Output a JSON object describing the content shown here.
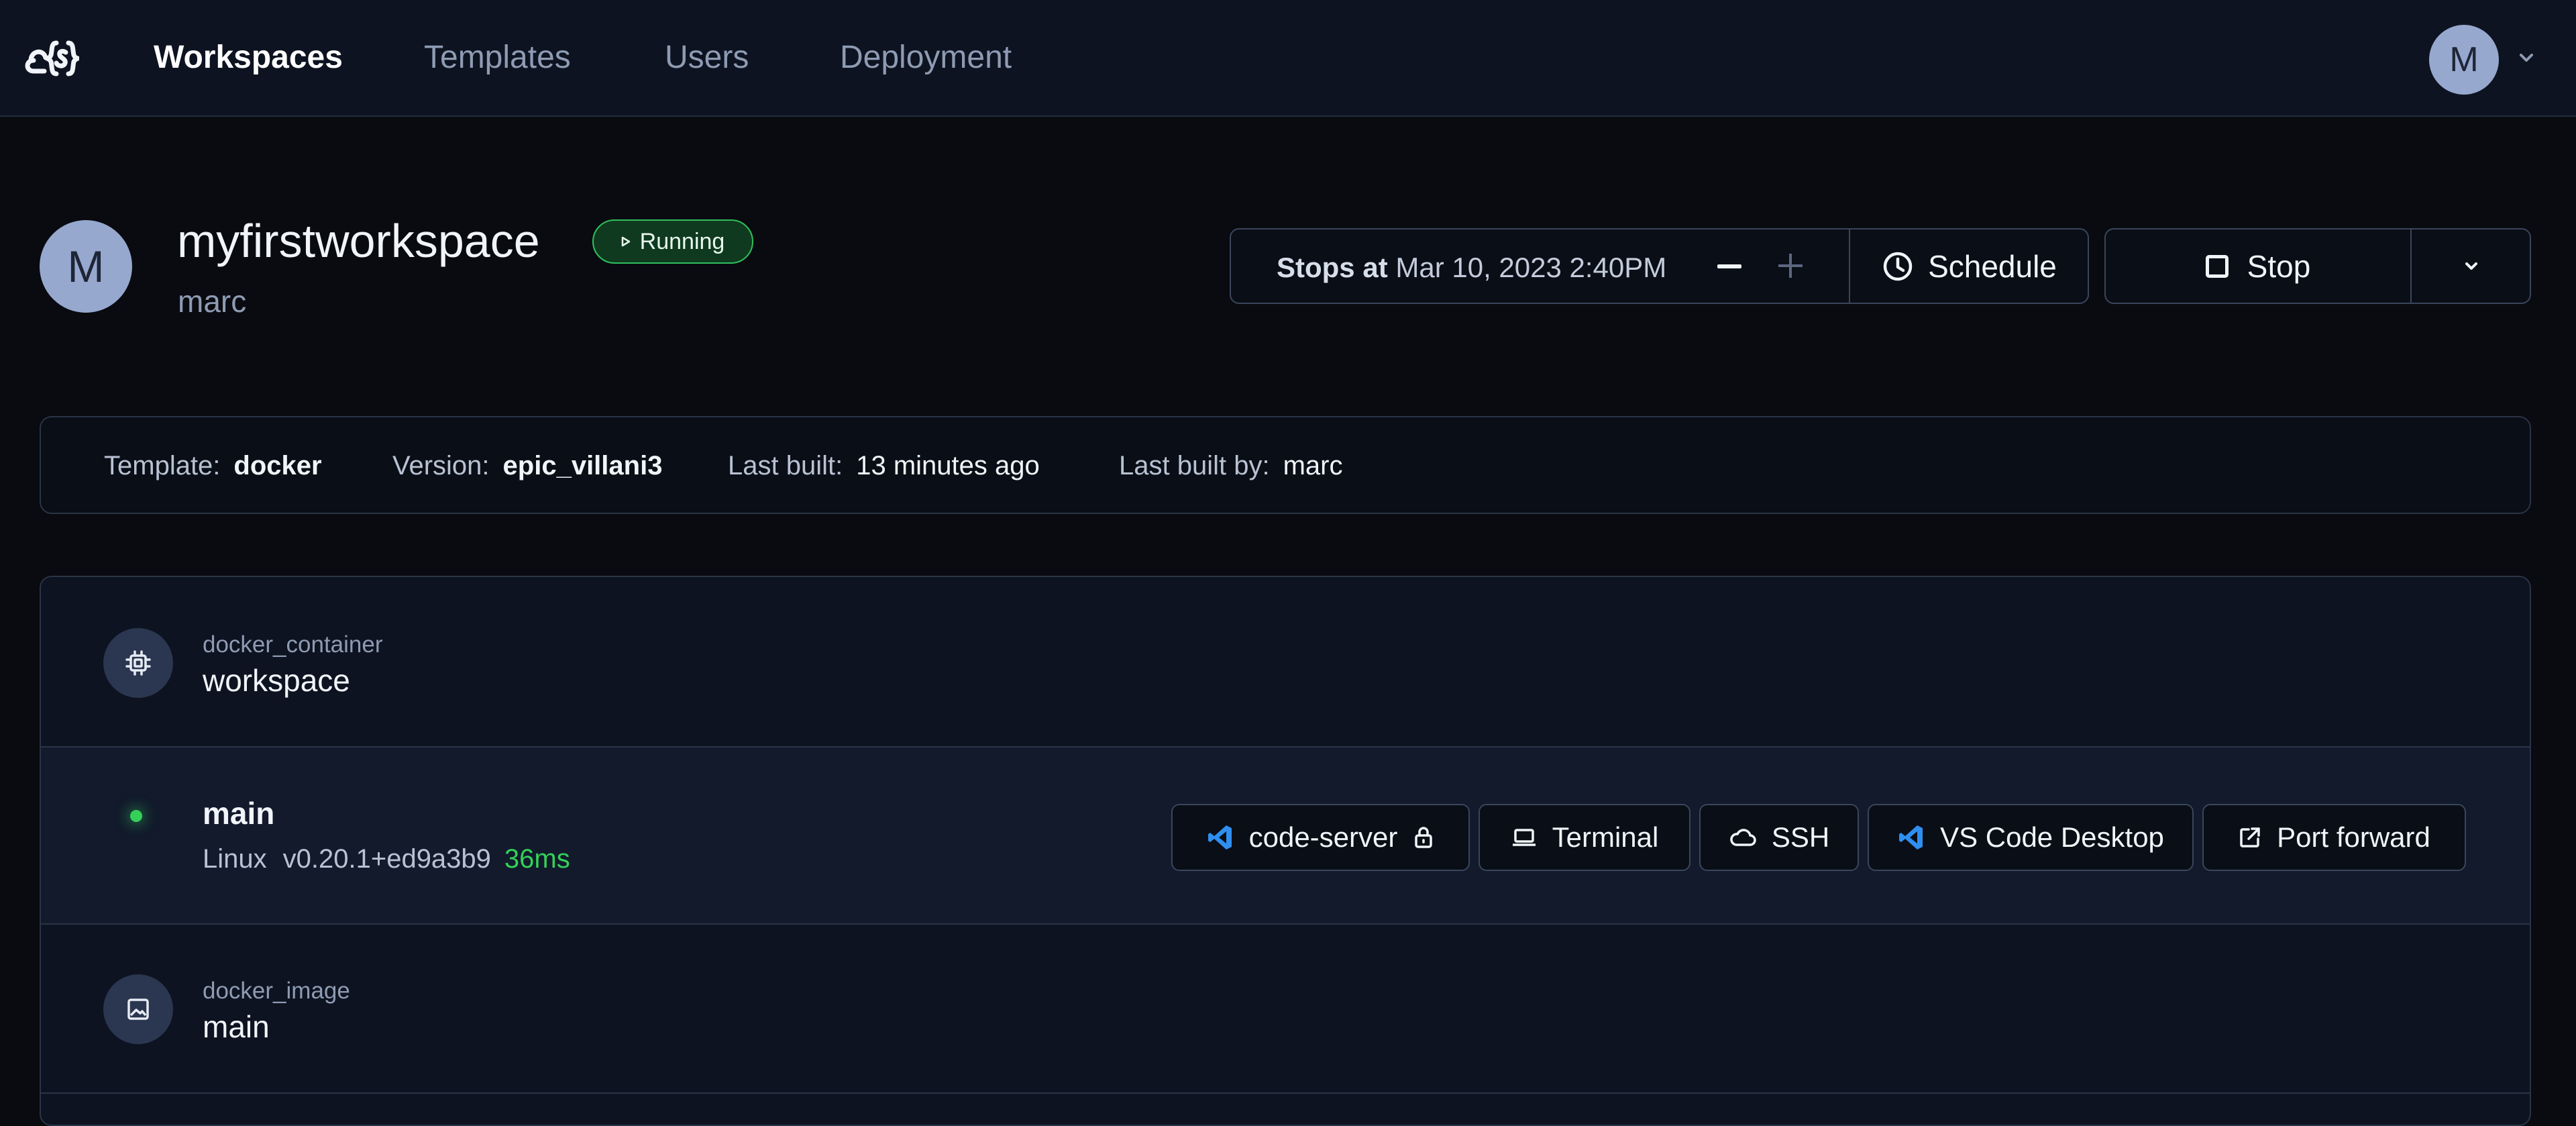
{
  "nav": {
    "items": [
      {
        "label": "Workspaces",
        "active": true
      },
      {
        "label": "Templates",
        "active": false
      },
      {
        "label": "Users",
        "active": false
      },
      {
        "label": "Deployment",
        "active": false
      }
    ],
    "user_initial": "M"
  },
  "workspace": {
    "initial": "M",
    "name": "myfirstworkspace",
    "owner": "marc",
    "status": "Running"
  },
  "schedule": {
    "stops_label": "Stops at",
    "stops_value": "Mar 10, 2023 2:40PM",
    "schedule_label": "Schedule"
  },
  "actions": {
    "stop_label": "Stop"
  },
  "info": {
    "template_label": "Template:",
    "template_value": "docker",
    "version_label": "Version:",
    "version_value": "epic_villani3",
    "last_built_label": "Last built:",
    "last_built_value": "13 minutes ago",
    "last_built_by_label": "Last built by:",
    "last_built_by_value": "marc"
  },
  "resources": [
    {
      "type": "docker_container",
      "name": "workspace",
      "icon": "chip-icon"
    },
    {
      "type": "docker_image",
      "name": "main",
      "icon": "image-icon"
    }
  ],
  "agent": {
    "name": "main",
    "os": "Linux",
    "version": "v0.20.1+ed9a3b9",
    "latency": "36ms",
    "status_color": "#34d058",
    "apps": [
      {
        "label": "code-server",
        "icon": "vscode-icon"
      },
      {
        "label": "Terminal",
        "icon": "laptop-icon"
      },
      {
        "label": "SSH",
        "icon": "cloud-icon"
      },
      {
        "label": "VS Code Desktop",
        "icon": "vscode-icon"
      },
      {
        "label": "Port forward",
        "icon": "external-link-icon"
      }
    ]
  },
  "colors": {
    "background": "#090b10",
    "topbar": "#0d1320",
    "accent_green": "#34d058",
    "vscode_blue": "#2f8ff0"
  }
}
